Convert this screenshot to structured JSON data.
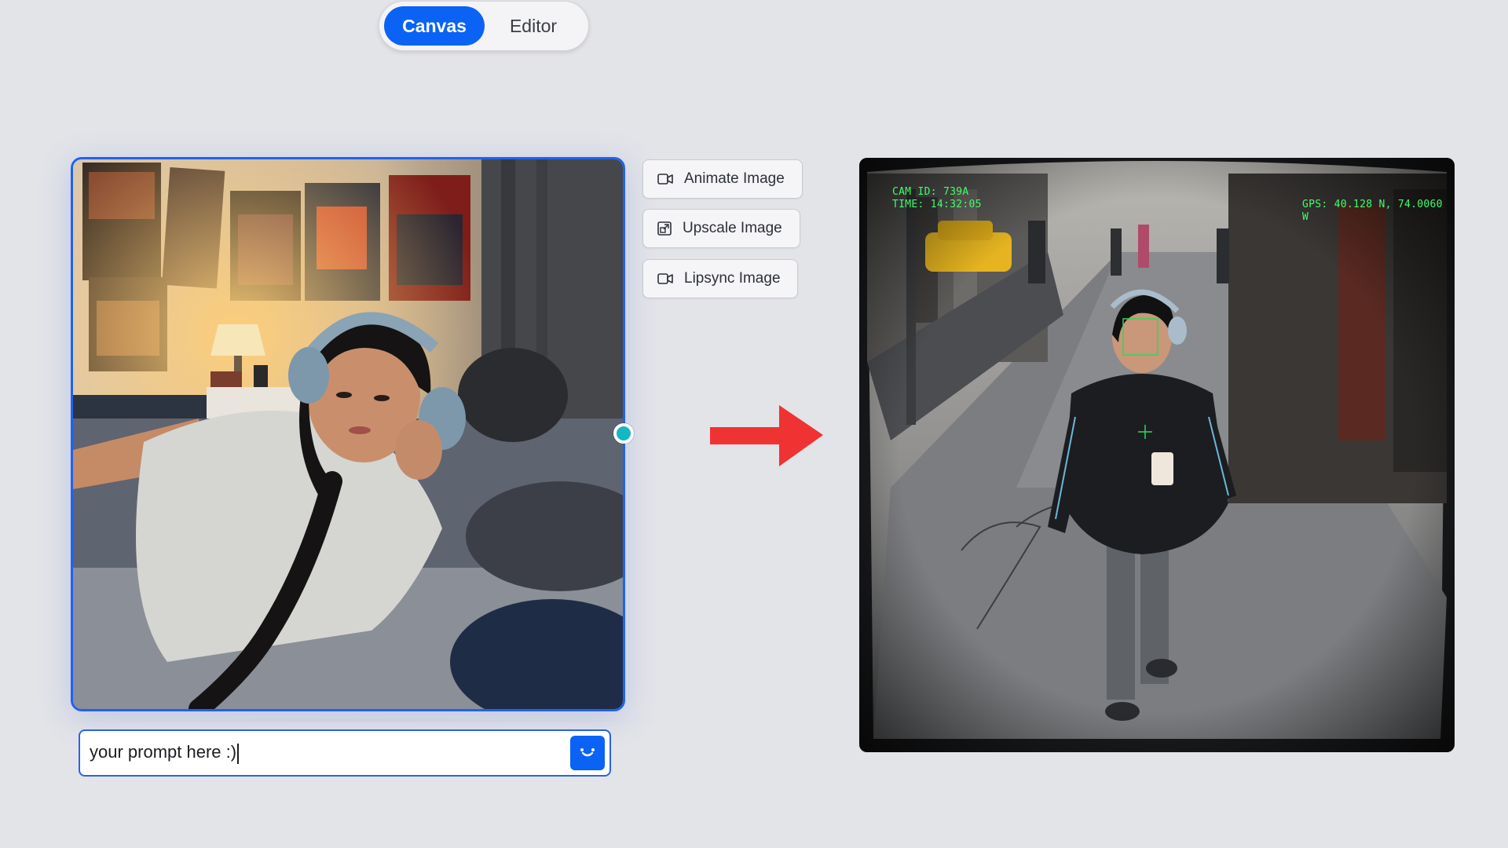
{
  "toggle": {
    "canvas_label": "Canvas",
    "editor_label": "Editor",
    "active": "Canvas"
  },
  "actions": {
    "animate_label": "Animate Image",
    "upscale_label": "Upscale Image",
    "lipsync_label": "Lipsync Image"
  },
  "prompt": {
    "value": "your prompt here :)"
  },
  "result_overlay": {
    "cam_id": "CAM ID: 739A",
    "time": "TIME: 14:32:05",
    "gps": "GPS: 40.128 N, 74.0060 W"
  },
  "colors": {
    "accent": "#0a63f5",
    "arrow": "#ef3333",
    "handle": "#16b7c4",
    "hud": "#3dff6a"
  },
  "icons": {
    "animate": "video-camera-icon",
    "upscale": "upscale-icon",
    "lipsync": "video-camera-icon",
    "send": "smile-icon"
  }
}
